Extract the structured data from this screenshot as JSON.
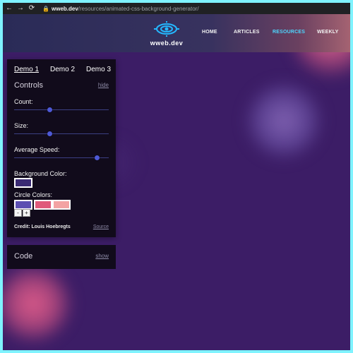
{
  "browser": {
    "url_domain": "wweb.dev",
    "url_path": "/resources/animated-css-background-generator/"
  },
  "site": {
    "logo_text": "wweb.dev",
    "nav": {
      "home": "HOME",
      "articles": "ARTICLES",
      "resources": "RESOURCES",
      "weekly": "WEEKLY"
    }
  },
  "panel": {
    "tabs": [
      "Demo 1",
      "Demo 2",
      "Demo 3"
    ],
    "controls_title": "Controls",
    "hide_label": "hide",
    "count_label": "Count:",
    "size_label": "Size:",
    "average_speed_label": "Average Speed:",
    "count_value_fraction": 0.38,
    "size_value_fraction": 0.38,
    "average_speed_value_fraction": 0.88,
    "background_color_label": "Background Color:",
    "background_color": "#3a2a73",
    "circle_colors_label": "Circle Colors:",
    "circle_colors": [
      "#5c4fb2",
      "#e05a7b",
      "#f3a3a3"
    ],
    "remove_color_label": "-",
    "add_color_label": "+",
    "credit_text": "Credit: Louis Hoebregts",
    "source_label": "Source"
  },
  "code_panel": {
    "title": "Code",
    "show_label": "show"
  }
}
